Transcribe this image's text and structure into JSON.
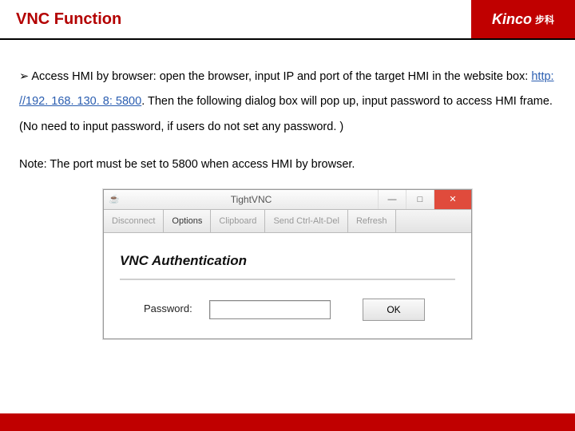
{
  "header": {
    "title": "VNC Function",
    "logo_text": "Kinco",
    "logo_cn": "步科"
  },
  "body": {
    "bullet": "➢",
    "text1": "Access HMI by browser: open the browser, input IP and port of the target HMI in the website box: ",
    "url": "http: //192. 168. 130. 8: 5800",
    "text2": ". Then the following dialog box will pop up, input password to access HMI frame. (No need to input password, if users do not set any password. )",
    "note": "Note: The port must be set to 5800 when access HMI by browser."
  },
  "dialog": {
    "java_icon": "☕",
    "title": "TightVNC",
    "min": "—",
    "max": "□",
    "close": "✕",
    "toolbar": {
      "disconnect": "Disconnect",
      "options": "Options",
      "clipboard": "Clipboard",
      "send_cad": "Send Ctrl-Alt-Del",
      "refresh": "Refresh"
    },
    "auth_title": "VNC Authentication",
    "password_label": "Password:",
    "ok_label": "OK"
  }
}
